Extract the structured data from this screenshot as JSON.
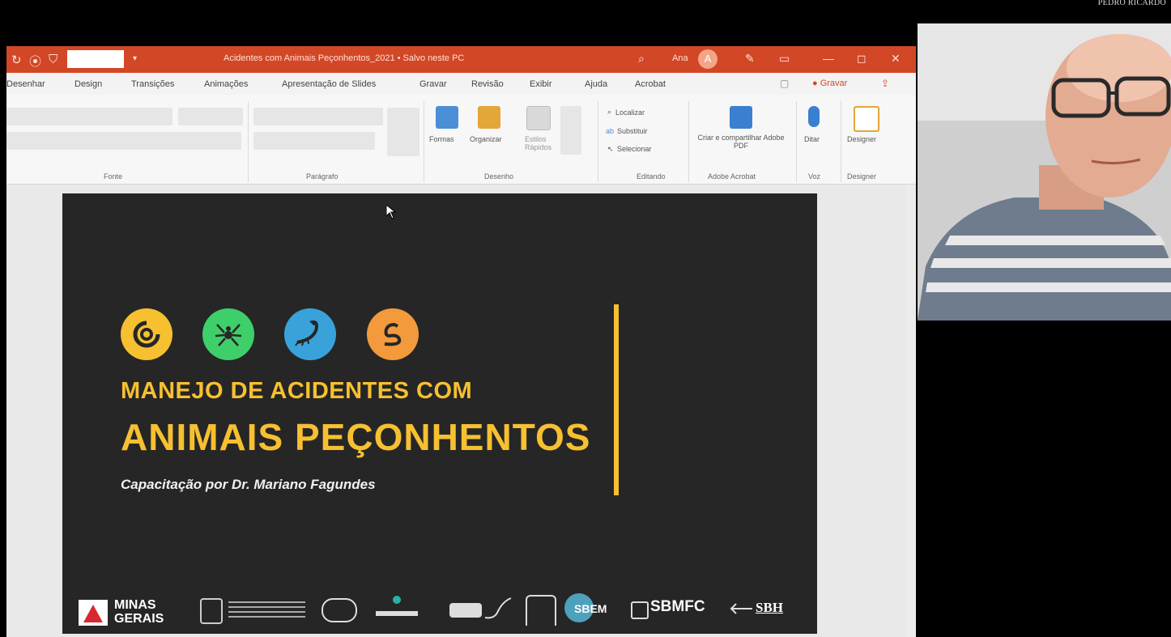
{
  "presenter": {
    "name_tag": "PEDRO RICARDO"
  },
  "window": {
    "title": "Acidentes com Animais Peçonhentos_2021 • Salvo neste PC",
    "user": "Ana",
    "user_initial": "A"
  },
  "tabs": [
    "Desenhar",
    "Design",
    "Transições",
    "Animações",
    "Apresentação de Slides",
    "Gravar",
    "Revisão",
    "Exibir",
    "Ajuda",
    "Acrobat"
  ],
  "record_button": "● Gravar",
  "ribbon": {
    "groups": [
      "Fonte",
      "Parágrafo",
      "Desenho",
      "Editando",
      "Adobe Acrobat",
      "Voz",
      "Designer"
    ],
    "commands": {
      "shapes": "Formas",
      "arrange": "Organizar",
      "quick_styles": "Estilos Rápidos",
      "find": "Localizar",
      "replace": "Substituir",
      "select": "Selecionar",
      "create_pdf": "Criar e compartilhar Adobe PDF",
      "dictate": "Ditar",
      "designer": "Designer"
    }
  },
  "slide": {
    "title_line1": "MANEJO DE ACIDENTES COM",
    "title_line2": "ANIMAIS PEÇONHENTOS",
    "subtitle": "Capacitação por Dr. Mariano Fagundes",
    "accent_color": "#f6c030",
    "badges": [
      {
        "icon": "centipede-icon",
        "color": "#f6c030"
      },
      {
        "icon": "spider-icon",
        "color": "#3ecf6a"
      },
      {
        "icon": "scorpion-icon",
        "color": "#3aa2db"
      },
      {
        "icon": "snake-icon",
        "color": "#f29a3c"
      }
    ],
    "logos": {
      "minas_gerais": "MINAS GERAIS",
      "sbmfc": "SBMFC",
      "sbh": "SBH",
      "sbem": "SBEM"
    }
  }
}
